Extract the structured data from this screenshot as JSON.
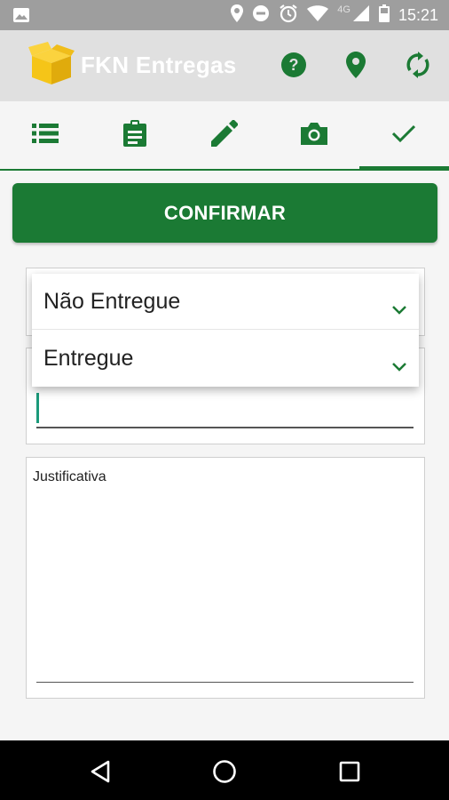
{
  "status_bar": {
    "time": "15:21",
    "network": "4G",
    "icons": [
      "image-icon",
      "location-icon",
      "do-not-disturb-icon",
      "alarm-icon",
      "wifi-icon",
      "signal-icon",
      "battery-icon"
    ]
  },
  "app_bar": {
    "title": "FKN Entregas",
    "logo": "box-icon",
    "actions": [
      "help-icon",
      "location-icon",
      "sync-icon"
    ]
  },
  "tabs": [
    {
      "icon": "list-icon",
      "active": false
    },
    {
      "icon": "clipboard-icon",
      "active": false
    },
    {
      "icon": "pencil-icon",
      "active": false
    },
    {
      "icon": "camera-icon",
      "active": false
    },
    {
      "icon": "check-icon",
      "active": true
    }
  ],
  "confirm_label": "CONFIRMAR",
  "dropdown": {
    "options": [
      "Não Entregue",
      "Entregue"
    ]
  },
  "justification": {
    "placeholder": "Justificativa"
  },
  "colors": {
    "primary": "#1b7a34",
    "app_bar": "#e0e0e0",
    "status_bar": "#9e9e9e",
    "logo": "#f5c518"
  },
  "nav": [
    "back-icon",
    "home-icon",
    "recents-icon"
  ]
}
